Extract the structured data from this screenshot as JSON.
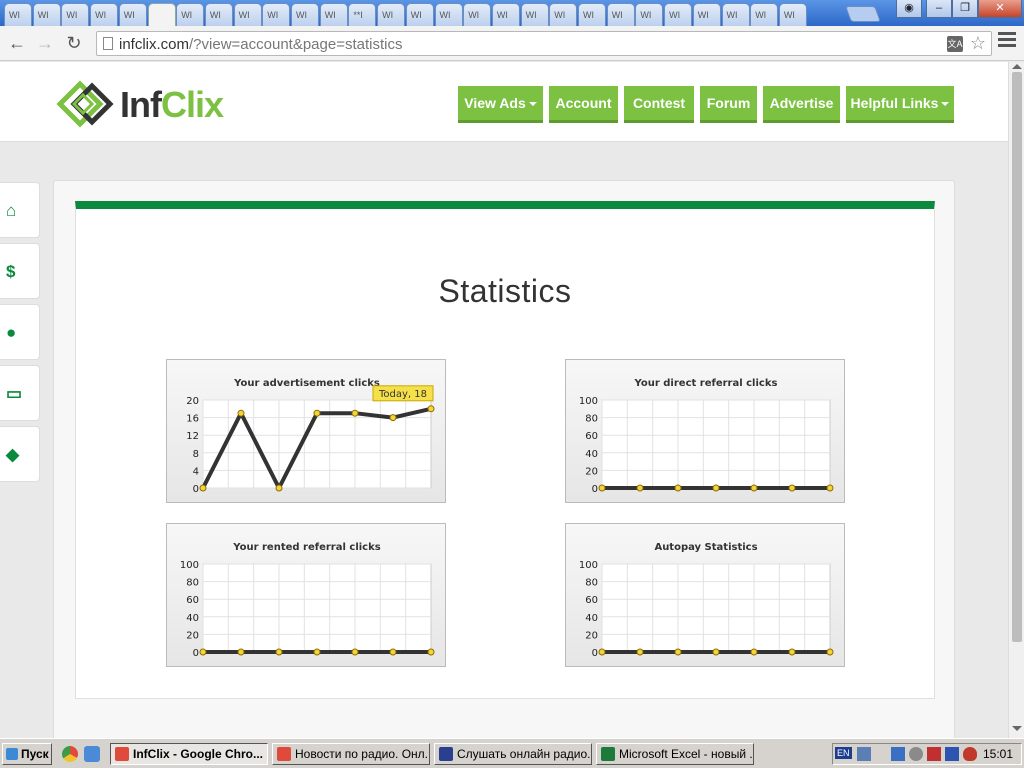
{
  "browser": {
    "tabs": [
      "WI",
      "WI",
      "WI",
      "WI",
      "WI",
      "",
      "WI",
      "WI",
      "WI",
      "WI",
      "WI",
      "WI",
      "**I",
      "WI",
      "WI",
      "WI",
      "WI",
      "WI",
      "WI",
      "WI",
      "WI",
      "WI",
      "WI",
      "WI",
      "WI",
      "WI",
      "WI",
      "WI"
    ],
    "active_tab_close": "×",
    "url_host": "infclix.com",
    "url_path": "/?view=account&page=statistics",
    "translate_icon": "translate-icon",
    "star_icon": "star-icon"
  },
  "site": {
    "logo_inf": "Inf",
    "logo_clix": "Clix",
    "nav": [
      {
        "label": "View Ads",
        "dropdown": true
      },
      {
        "label": "Account",
        "dropdown": false
      },
      {
        "label": "Contest",
        "dropdown": false
      },
      {
        "label": "Forum",
        "dropdown": false
      },
      {
        "label": "Advertise",
        "dropdown": false
      },
      {
        "label": "Helpful Links",
        "dropdown": true
      }
    ],
    "side_icons": [
      "home-icon",
      "dollar-icon",
      "user-icon",
      "presentation-icon",
      "tags-icon"
    ],
    "side_glyphs": [
      "⌂",
      "$",
      "●",
      "▭",
      "◆"
    ],
    "accent": "#0b8a3e",
    "nav_color": "#7cc142"
  },
  "page": {
    "title": "Statistics"
  },
  "chart_data": [
    {
      "type": "line",
      "title": "Your advertisement clicks",
      "ylim": [
        0,
        20
      ],
      "yticks": [
        0,
        4,
        8,
        12,
        16,
        20
      ],
      "values": [
        0,
        17,
        0,
        17,
        17,
        16,
        18
      ],
      "tooltip": "Today, 18",
      "line_color": "#333333"
    },
    {
      "type": "line",
      "title": "Your direct referral clicks",
      "ylim": [
        0,
        100
      ],
      "yticks": [
        0,
        20,
        40,
        60,
        80,
        100
      ],
      "values": [
        0,
        0,
        0,
        0,
        0,
        0,
        0
      ],
      "line_color": "#333333"
    },
    {
      "type": "line",
      "title": "Your rented referral clicks",
      "ylim": [
        0,
        100
      ],
      "yticks": [
        0,
        20,
        40,
        60,
        80,
        100
      ],
      "values": [
        0,
        0,
        0,
        0,
        0,
        0,
        0
      ],
      "line_color": "#333333"
    },
    {
      "type": "line",
      "title": "Autopay Statistics",
      "ylim": [
        0,
        100
      ],
      "yticks": [
        0,
        20,
        40,
        60,
        80,
        100
      ],
      "values": [
        0,
        0,
        0,
        0,
        0,
        0,
        0
      ],
      "line_color": "#333333"
    }
  ],
  "taskbar": {
    "start": "Пуск",
    "tasks": [
      {
        "label": "InfClix - Google Chro...",
        "active": true,
        "icon": "chrome-icon",
        "color": "#e04a3a"
      },
      {
        "label": "Новости по радио. Онл...",
        "active": false,
        "icon": "chrome-icon",
        "color": "#e04a3a"
      },
      {
        "label": "Слушать онлайн радио...",
        "active": false,
        "icon": "p-icon",
        "color": "#2a3f8f"
      },
      {
        "label": "Microsoft Excel - новый ...",
        "active": false,
        "icon": "excel-icon",
        "color": "#1d7a3a"
      }
    ],
    "lang": "EN",
    "clock": "15:01"
  }
}
